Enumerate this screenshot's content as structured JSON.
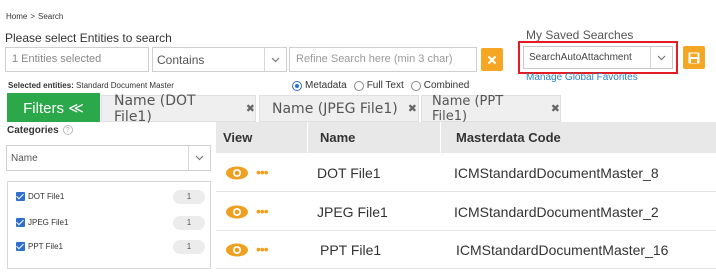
{
  "breadcrumb": {
    "home": "Home",
    "sep": ">",
    "current": "Search"
  },
  "prompt": "Please select Entities to search",
  "search": {
    "entities_value": "1 Entities selected",
    "operator_value": "Contains",
    "refine_placeholder": "Refine Search here (min 3 char)"
  },
  "saved_searches": {
    "title": "My Saved Searches",
    "selected": "SearchAutoAttachment",
    "manage_link": "Manage Global Favorites",
    "highlight_color": "#e31b23"
  },
  "selected_entities": {
    "label": "Selected entities:",
    "value": "Standard Document Master"
  },
  "search_mode": {
    "options": [
      "Metadata",
      "Full Text",
      "Combined"
    ],
    "selected": "Metadata"
  },
  "filters_button": "Filters ≪",
  "tabs": [
    {
      "label": "Name (DOT File1)"
    },
    {
      "label": "Name (JPEG File1)"
    },
    {
      "label": "Name (PPT File1)"
    }
  ],
  "categories": {
    "title": "Categories",
    "select_value": "Name"
  },
  "facets": [
    {
      "label": "DOT File1",
      "count": "1",
      "checked": true
    },
    {
      "label": "JPEG File1",
      "count": "1",
      "checked": true
    },
    {
      "label": "PPT File1",
      "count": "1",
      "checked": true
    }
  ],
  "grid": {
    "columns": [
      "View",
      "Name",
      "Masterdata Code"
    ],
    "rows": [
      {
        "name": "DOT File1",
        "code": "ICMStandardDocumentMaster_8"
      },
      {
        "name": "JPEG File1",
        "code": "ICMStandardDocumentMaster_2"
      },
      {
        "name": "PPT File1",
        "code": "ICMStandardDocumentMaster_16"
      }
    ]
  },
  "colors": {
    "accent_orange": "#f5a623",
    "filters_green": "#2ba84a",
    "link_blue": "#2c7fc1"
  }
}
